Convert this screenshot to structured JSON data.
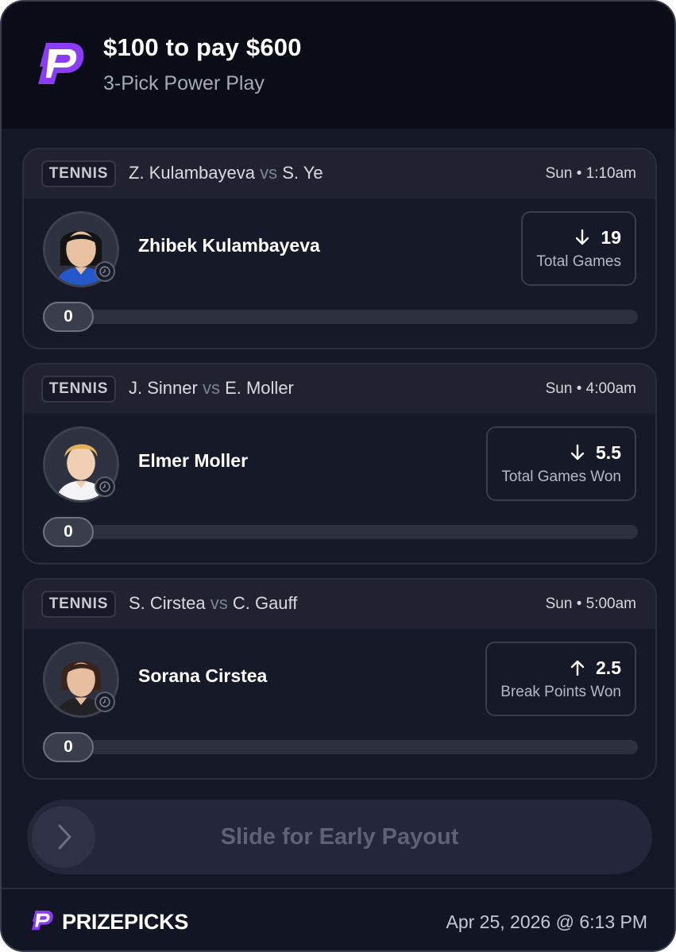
{
  "header": {
    "title": "$100 to pay $600",
    "subtitle": "3-Pick Power Play",
    "logo_icon": "prizepicks-logo-icon"
  },
  "picks": [
    {
      "sport": "TENNIS",
      "player_a": "Z. Kulambayeva",
      "vs": "vs",
      "player_b": "S. Ye",
      "time": "Sun • 1:10am",
      "player_name": "Zhibek Kulambayeva",
      "direction": "down",
      "line": "19",
      "stat": "Total Games",
      "progress": "0"
    },
    {
      "sport": "TENNIS",
      "player_a": "J. Sinner",
      "vs": "vs",
      "player_b": "E. Moller",
      "time": "Sun • 4:00am",
      "player_name": "Elmer Moller",
      "direction": "down",
      "line": "5.5",
      "stat": "Total Games Won",
      "progress": "0"
    },
    {
      "sport": "TENNIS",
      "player_a": "S. Cirstea",
      "vs": "vs",
      "player_b": "C. Gauff",
      "time": "Sun • 5:00am",
      "player_name": "Sorana Cirstea",
      "direction": "up",
      "line": "2.5",
      "stat": "Break Points Won",
      "progress": "0"
    }
  ],
  "slider": {
    "label": "Slide for Early Payout",
    "icon": "chevron-right-icon"
  },
  "footer": {
    "brand": "PRIZEPICKS",
    "datetime": "Apr 25, 2026 @ 6:13 PM"
  },
  "colors": {
    "background": "#141725",
    "header": "#0a0c17",
    "brand_purple": "#8a3cf6",
    "card_border": "#2b2e3d"
  }
}
